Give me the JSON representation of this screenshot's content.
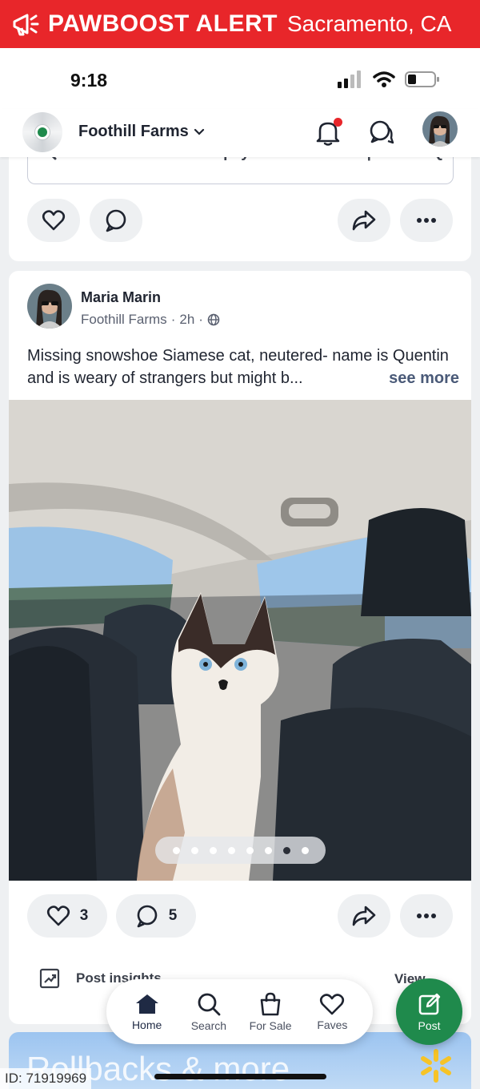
{
  "alert": {
    "brand": "PAWBOOST ALERT",
    "city": "Sacramento, CA",
    "bg": "#e8262a"
  },
  "status": {
    "time": "9:18"
  },
  "appbar": {
    "neighborhood": "Foothill Farms",
    "accent": "#1f8a4c"
  },
  "previous_card": {
    "link_text": "Sacramento SPCA Spay & Neuter Clinic | Clinic HQ ..."
  },
  "post": {
    "author": "Maria Marin",
    "neighborhood": "Foothill Farms",
    "age": "2h",
    "body": "Missing snowshoe Siamese cat, neutered- name is Quentin and is weary of strangers but might b...",
    "see_more": "see more",
    "likes": "3",
    "comments": "5",
    "carousel": {
      "total": 8,
      "active": 7
    },
    "insights_label": "Post insights",
    "view_label": "View"
  },
  "nav": {
    "home": "Home",
    "search": "Search",
    "for_sale": "For Sale",
    "faves": "Faves",
    "post": "Post"
  },
  "promo": {
    "text": "Rollbacks & more"
  },
  "id_label": "ID: 71919969"
}
